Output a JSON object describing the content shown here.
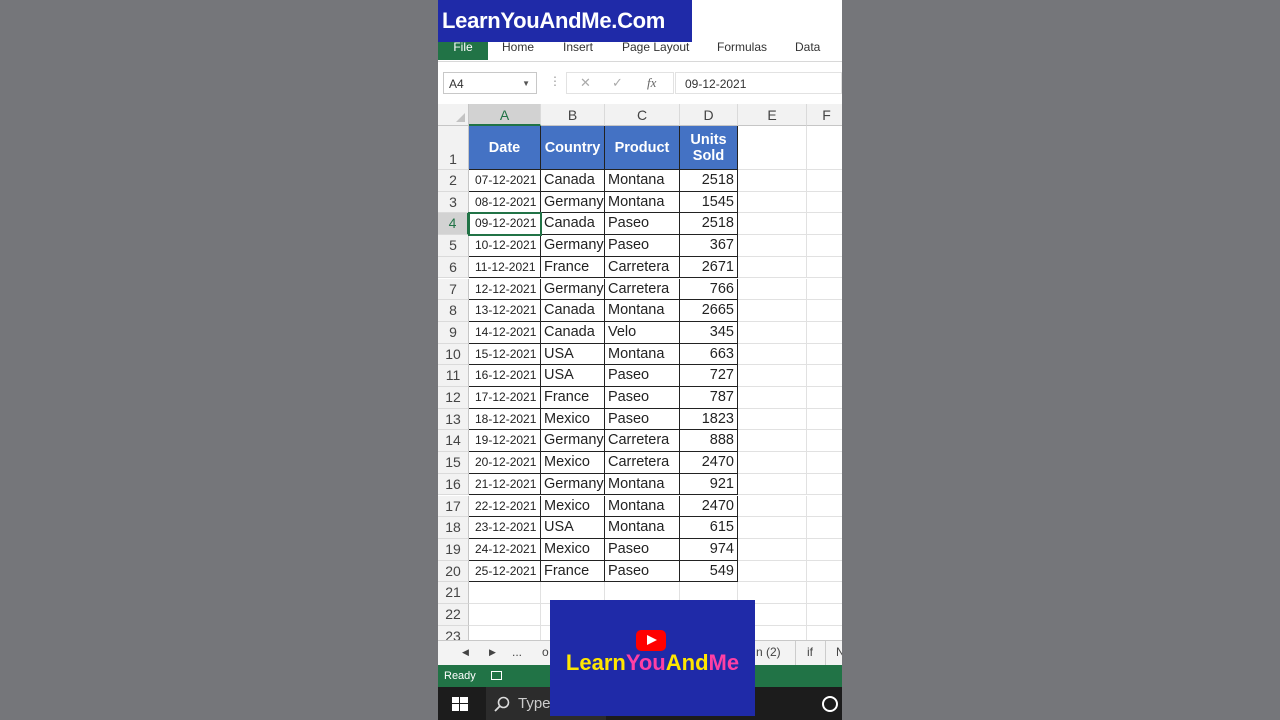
{
  "brand": {
    "banner_text": "LearnYouAndMe.Com"
  },
  "ribbon": {
    "tabs": [
      "File",
      "Home",
      "Insert",
      "Page Layout",
      "Formulas",
      "Data"
    ]
  },
  "formula_bar": {
    "name_box": "A4",
    "fx_label": "fx",
    "value": "09-12-2021"
  },
  "columns": [
    "A",
    "B",
    "C",
    "D",
    "E",
    "F"
  ],
  "table": {
    "headers": [
      "Date",
      "Country",
      "Product",
      "Units Sold"
    ],
    "rows": [
      [
        "07-12-2021",
        "Canada",
        "Montana",
        "2518"
      ],
      [
        "08-12-2021",
        "Germany",
        "Montana",
        "1545"
      ],
      [
        "09-12-2021",
        "Canada",
        "Paseo",
        "2518"
      ],
      [
        "10-12-2021",
        "Germany",
        "Paseo",
        "367"
      ],
      [
        "11-12-2021",
        "France",
        "Carretera",
        "2671"
      ],
      [
        "12-12-2021",
        "Germany",
        "Carretera",
        "766"
      ],
      [
        "13-12-2021",
        "Canada",
        "Montana",
        "2665"
      ],
      [
        "14-12-2021",
        "Canada",
        "Velo",
        "345"
      ],
      [
        "15-12-2021",
        "USA",
        "Montana",
        "663"
      ],
      [
        "16-12-2021",
        "USA",
        "Paseo",
        "727"
      ],
      [
        "17-12-2021",
        "France",
        "Paseo",
        "787"
      ],
      [
        "18-12-2021",
        "Mexico",
        "Paseo",
        "1823"
      ],
      [
        "19-12-2021",
        "Germany",
        "Carretera",
        "888"
      ],
      [
        "20-12-2021",
        "Mexico",
        "Carretera",
        "2470"
      ],
      [
        "21-12-2021",
        "Germany",
        "Montana",
        "921"
      ],
      [
        "22-12-2021",
        "Mexico",
        "Montana",
        "2470"
      ],
      [
        "23-12-2021",
        "USA",
        "Montana",
        "615"
      ],
      [
        "24-12-2021",
        "Mexico",
        "Paseo",
        "974"
      ],
      [
        "25-12-2021",
        "France",
        "Paseo",
        "549"
      ]
    ]
  },
  "row_numbers": [
    "1",
    "2",
    "3",
    "4",
    "5",
    "6",
    "7",
    "8",
    "9",
    "10",
    "11",
    "12",
    "13",
    "14",
    "15",
    "16",
    "17",
    "18",
    "19",
    "20",
    "21",
    "22",
    "23"
  ],
  "selected_cell": "A4",
  "sheet_tabs": {
    "ellipsis": "...",
    "partial_left": "o",
    "tab_partial": "n (2)",
    "tab_if": "if",
    "partial_right": "N"
  },
  "status": {
    "ready": "Ready"
  },
  "taskbar": {
    "search_placeholder": "Type"
  },
  "logo": {
    "part1": "Learn",
    "part2": "You",
    "part3": "And",
    "part4": "Me"
  },
  "colors": {
    "excel_green": "#217346",
    "header_blue": "#4472c4",
    "brand_blue": "#1f2aa8",
    "youtube_red": "#ff0000",
    "logo_yellow": "#ffe600",
    "logo_pink": "#ff3fa4"
  }
}
